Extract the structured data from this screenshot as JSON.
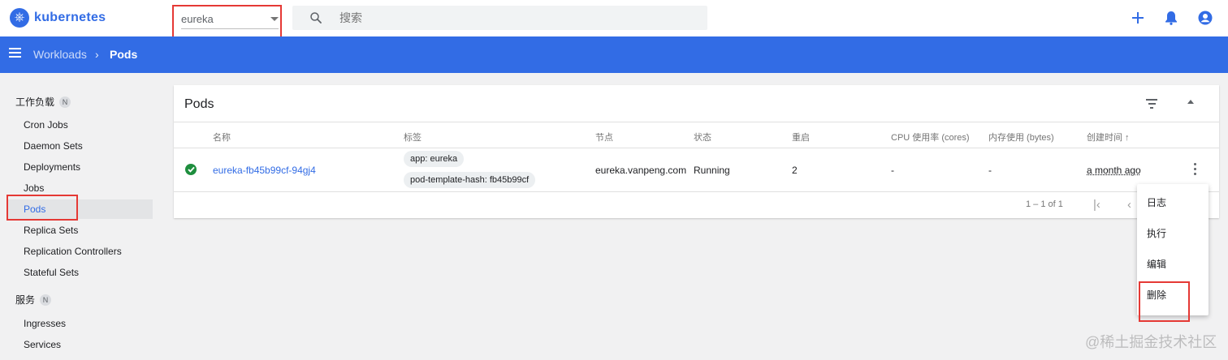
{
  "app": {
    "name": "kubernetes"
  },
  "namespace": {
    "selected": "eureka"
  },
  "search": {
    "placeholder": "搜索"
  },
  "breadcrumb": {
    "parent": "Workloads",
    "separator": "›",
    "current": "Pods"
  },
  "sidebar": {
    "groups": [
      {
        "label": "工作负载",
        "badge": "N"
      },
      {
        "label": "服务",
        "badge": "N"
      }
    ],
    "items": [
      {
        "label": "Cron Jobs"
      },
      {
        "label": "Daemon Sets"
      },
      {
        "label": "Deployments"
      },
      {
        "label": "Jobs"
      },
      {
        "label": "Pods",
        "active": true
      },
      {
        "label": "Replica Sets"
      },
      {
        "label": "Replication Controllers"
      },
      {
        "label": "Stateful Sets"
      },
      {
        "label": "Ingresses"
      },
      {
        "label": "Services"
      }
    ]
  },
  "card": {
    "title": "Pods",
    "columns": [
      "名称",
      "标签",
      "节点",
      "状态",
      "重启",
      "CPU 使用率 (cores)",
      "内存使用 (bytes)",
      "创建时间 ↑"
    ],
    "rows": [
      {
        "name": "eureka-fb45b99cf-94gj4",
        "labels": [
          "app: eureka",
          "pod-template-hash: fb45b99cf"
        ],
        "node": "eureka.vanpeng.com",
        "status": "Running",
        "restarts": "2",
        "cpu": "-",
        "memory": "-",
        "created": "a month ago"
      }
    ],
    "pagination": "1 – 1 of 1"
  },
  "menu": {
    "items": [
      "日志",
      "执行",
      "编辑",
      "删除"
    ]
  },
  "watermark": "@稀土掘金技术社区",
  "colors": {
    "primary": "#326ce5",
    "highlight": "#e53935",
    "success": "#1e8e3e"
  }
}
